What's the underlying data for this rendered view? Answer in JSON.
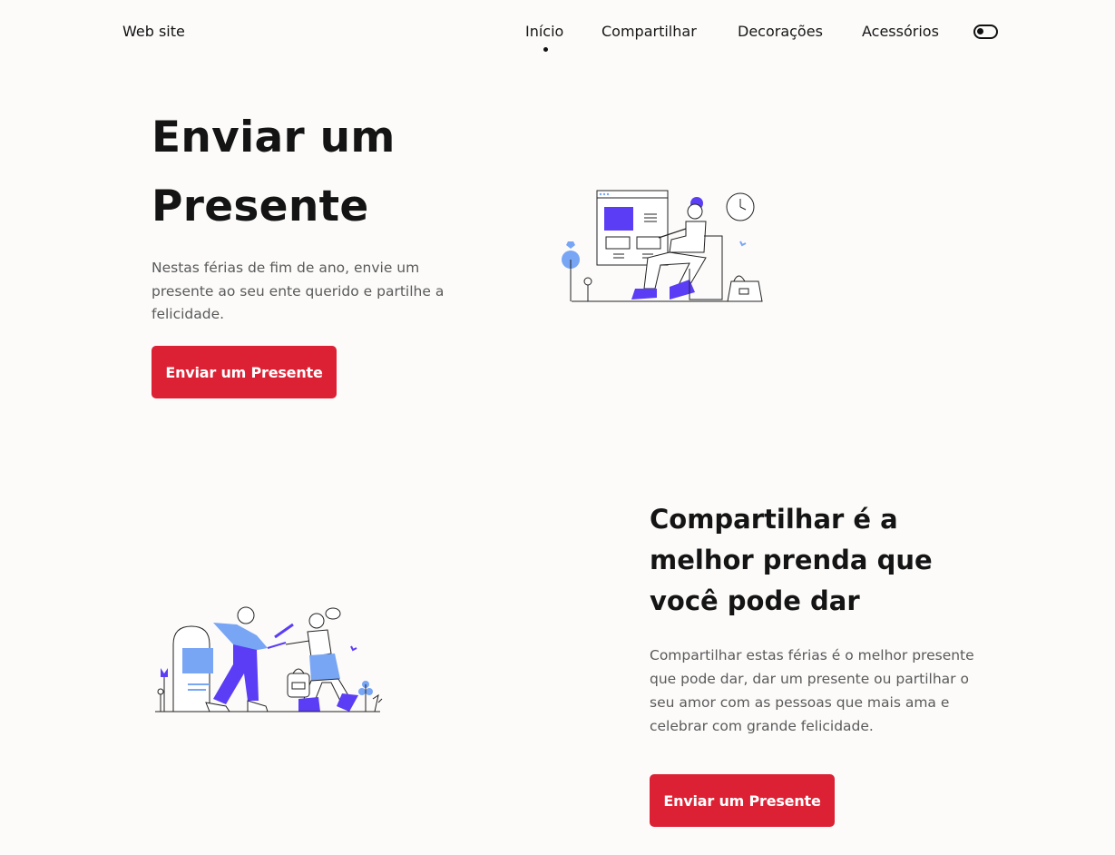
{
  "header": {
    "logo": "Web site",
    "nav": [
      {
        "label": "Início",
        "active": true
      },
      {
        "label": "Compartilhar",
        "active": false
      },
      {
        "label": "Decorações",
        "active": false
      },
      {
        "label": "Acessórios",
        "active": false
      }
    ],
    "theme_toggle_icon": "toggle-switch-icon"
  },
  "hero": {
    "title": "Enviar um Presente",
    "text": "Nestas férias de fim de ano, envie um presente ao seu ente querido e partilhe a felicidade.",
    "button_label": "Enviar um Presente",
    "illustration": "woman-browsing-online-store-illustration"
  },
  "share": {
    "title": "Compartilhar é a melhor prenda que\nvocê pode dar",
    "text": "Compartilhar estas férias é o melhor presente que pode dar, dar um presente ou partilhar o seu amor com as pessoas que mais ama e celebrar com grande felicidade.",
    "button_label": "Enviar um Presente",
    "illustration": "people-exchanging-gift-illustration"
  },
  "colors": {
    "background": "#fcfbfa",
    "accent_button": "#dc2134",
    "illustration_primary": "#5b3df5",
    "illustration_secondary": "#78a6f5"
  }
}
